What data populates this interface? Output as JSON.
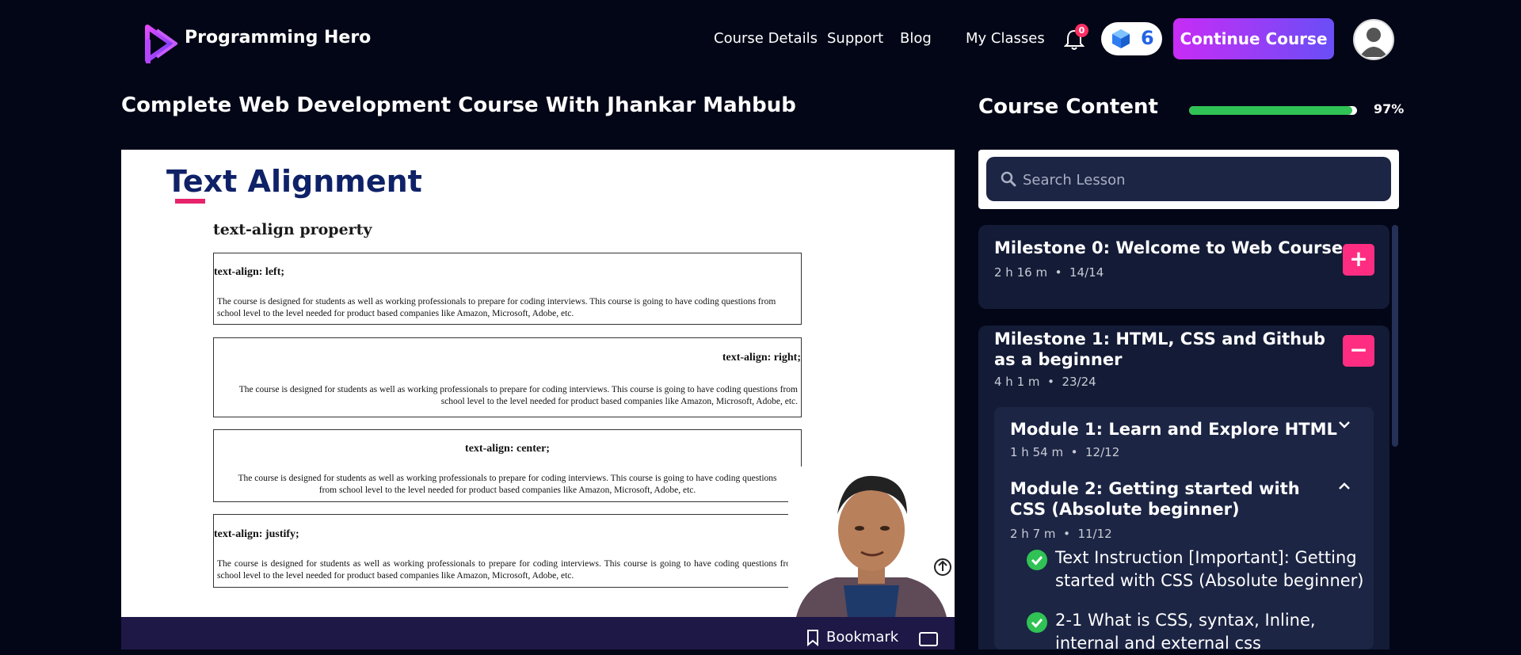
{
  "brand": {
    "name": "Programming Hero"
  },
  "nav": {
    "links": [
      "Course Details",
      "Support",
      "Blog",
      "My Classes"
    ],
    "notification_count": "0",
    "gems": "6",
    "continue_label": "Continue Course"
  },
  "course": {
    "title": "Complete Web Development Course With Jhankar Mahbub"
  },
  "video": {
    "slide_title": "Text Alignment",
    "slide_subtitle": "text-align property",
    "demos": [
      {
        "heading": "text-align: left;",
        "text": "The course is designed for students as well as working professionals to prepare for coding interviews. This course is going to have coding questions from school level to the level needed for product based companies like Amazon, Microsoft, Adobe, etc."
      },
      {
        "heading": "text-align: right;",
        "text": "The course is designed for students as well as working professionals to prepare for coding interviews. This course is going to have coding questions from school level to the level needed for product based companies like Amazon, Microsoft, Adobe, etc."
      },
      {
        "heading": "text-align: center;",
        "text": "The course is designed for students as well as working professionals to prepare for coding interviews. This course is going to have coding questions from school level to the level needed for product based companies like Amazon, Microsoft, Adobe, etc."
      },
      {
        "heading": "text-align: justify;",
        "text": "The course is designed for students as well as working professionals to prepare for coding interviews. This course is going to have coding questions from school level to the level needed for product based companies like Amazon, Microsoft, Adobe, etc."
      }
    ],
    "bookmark_label": "Bookmark"
  },
  "sidebar": {
    "title": "Course Content",
    "progress_percent": 97,
    "progress_label": "97%",
    "search_placeholder": "Search Lesson",
    "milestones": [
      {
        "title": "Milestone 0: Welcome to Web Course",
        "duration": "2 h 16 m",
        "count": "14/14",
        "toggle": "+"
      },
      {
        "title": "Milestone 1: HTML, CSS and Github as a beginner",
        "duration": "4 h 1 m",
        "count": "23/24",
        "toggle": "−"
      }
    ],
    "modules": [
      {
        "title": "Module 1: Learn and Explore HTML",
        "duration": "1 h 54 m",
        "count": "12/12"
      },
      {
        "title": "Module 2: Getting started with CSS (Absolute beginner)",
        "duration": "2 h 7 m",
        "count": "11/12"
      }
    ],
    "lessons": [
      "Text Instruction [Important]: Getting started with CSS (Absolute beginner)",
      "2-1 What is CSS, syntax, Inline, internal and external css"
    ]
  },
  "colors": {
    "background": "#030617",
    "accent_pink": "#ff2d82",
    "progress_green": "#30c254",
    "panel": "#131b36"
  }
}
